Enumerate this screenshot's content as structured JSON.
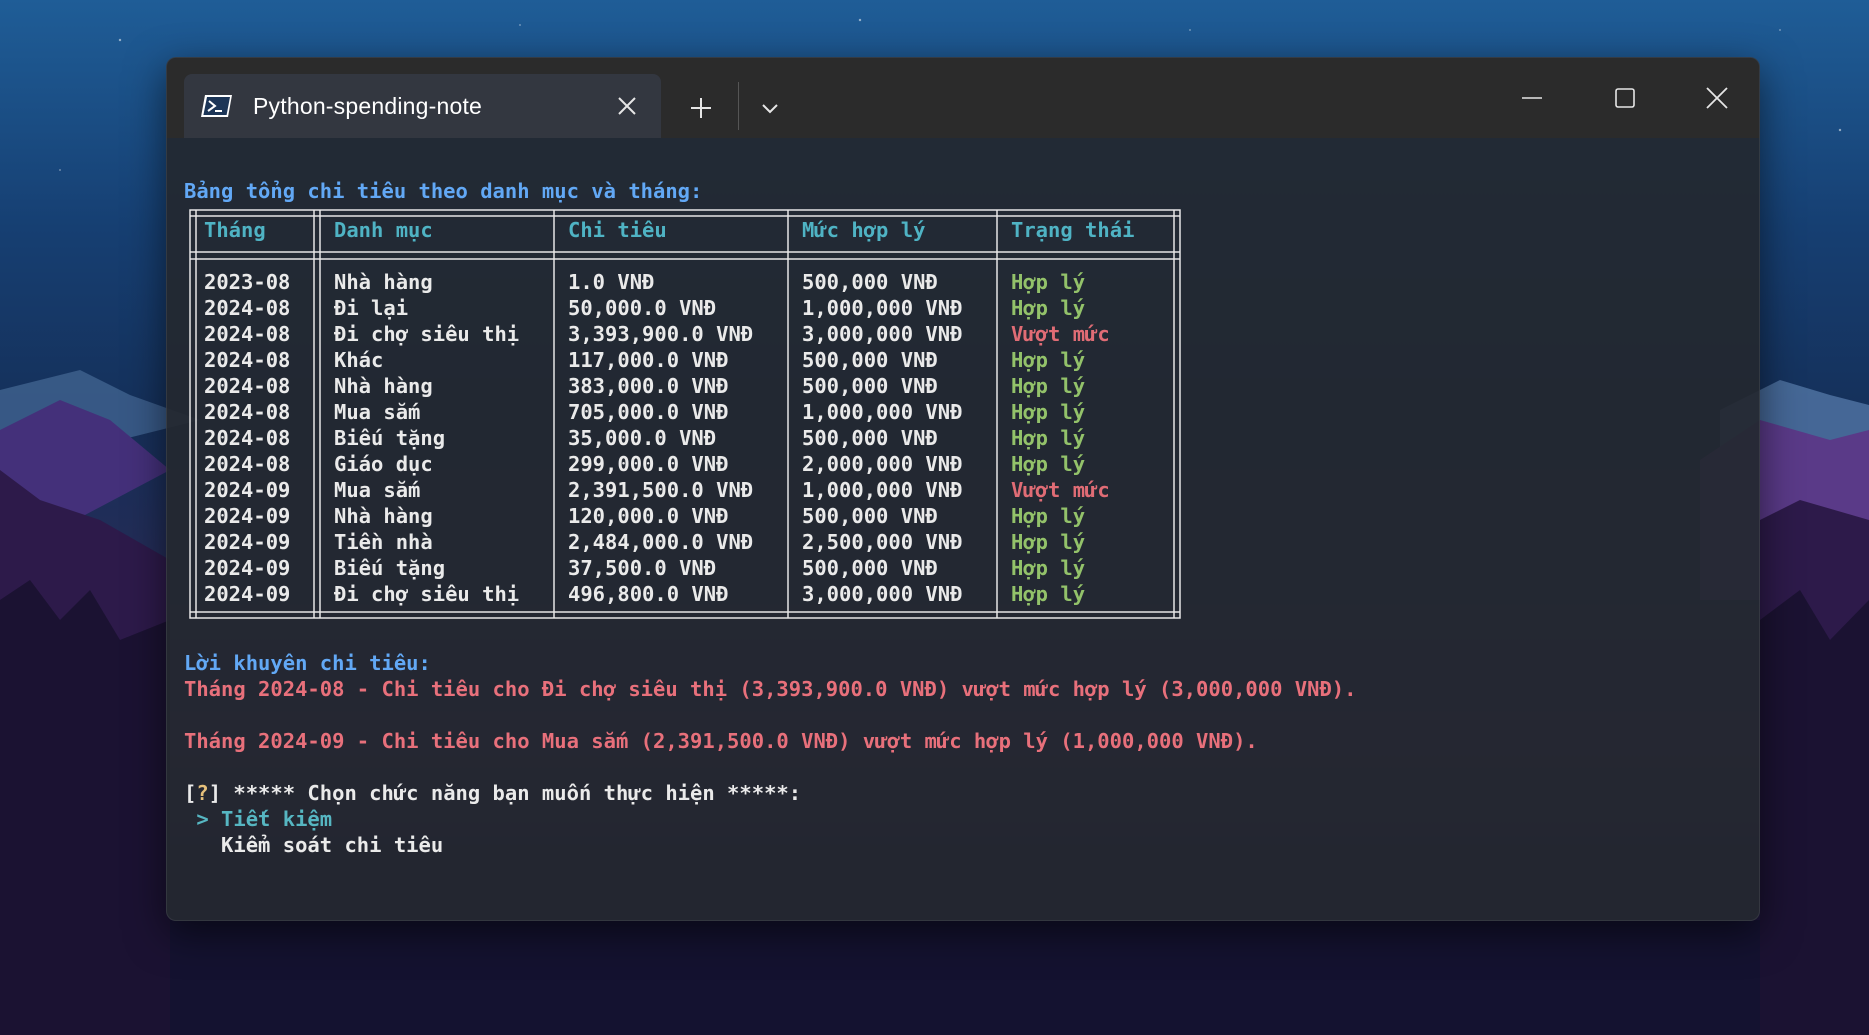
{
  "window": {
    "tab_title": "Python-spending-note",
    "icons": [
      "powershell-icon",
      "close-icon",
      "plus-icon",
      "chevron-down-icon",
      "minimize-icon",
      "maximize-icon",
      "close-window-icon"
    ]
  },
  "terminal": {
    "table_heading": "Bảng tổng chi tiêu theo danh mục và tháng:",
    "headers": [
      "Tháng",
      "Danh mục",
      "Chi tiêu",
      "Mức hợp lý",
      "Trạng thái"
    ],
    "rows": [
      [
        "2023-08",
        "Nhà hàng",
        "1.0 VNĐ",
        "500,000 VNĐ",
        "Hợp lý"
      ],
      [
        "2024-08",
        "Đi lại",
        "50,000.0 VNĐ",
        "1,000,000 VNĐ",
        "Hợp lý"
      ],
      [
        "2024-08",
        "Đi chợ siêu thị",
        "3,393,900.0 VNĐ",
        "3,000,000 VNĐ",
        "Vượt mức"
      ],
      [
        "2024-08",
        "Khác",
        "117,000.0 VNĐ",
        "500,000 VNĐ",
        "Hợp lý"
      ],
      [
        "2024-08",
        "Nhà hàng",
        "383,000.0 VNĐ",
        "500,000 VNĐ",
        "Hợp lý"
      ],
      [
        "2024-08",
        "Mua sắm",
        "705,000.0 VNĐ",
        "1,000,000 VNĐ",
        "Hợp lý"
      ],
      [
        "2024-08",
        "Biếu tặng",
        "35,000.0 VNĐ",
        "500,000 VNĐ",
        "Hợp lý"
      ],
      [
        "2024-08",
        "Giáo dục",
        "299,000.0 VNĐ",
        "2,000,000 VNĐ",
        "Hợp lý"
      ],
      [
        "2024-09",
        "Mua sắm",
        "2,391,500.0 VNĐ",
        "1,000,000 VNĐ",
        "Vượt mức"
      ],
      [
        "2024-09",
        "Nhà hàng",
        "120,000.0 VNĐ",
        "500,000 VNĐ",
        "Hợp lý"
      ],
      [
        "2024-09",
        "Tiền nhà",
        "2,484,000.0 VNĐ",
        "2,500,000 VNĐ",
        "Hợp lý"
      ],
      [
        "2024-09",
        "Biếu tặng",
        "37,500.0 VNĐ",
        "500,000 VNĐ",
        "Hợp lý"
      ],
      [
        "2024-09",
        "Đi chợ siêu thị",
        "496,800.0 VNĐ",
        "3,000,000 VNĐ",
        "Hợp lý"
      ]
    ],
    "status_colors": {
      "Hợp lý": "#93c26a",
      "Vượt mức": "#e06c75"
    },
    "advice_heading": "Lời khuyên chi tiêu:",
    "advice": [
      "Tháng 2024-08 - Chi tiêu cho Đi chợ siêu thị (3,393,900.0 VNĐ) vượt mức hợp lý (3,000,000 VNĐ).",
      "Tháng 2024-09 - Chi tiêu cho Mua sắm (2,391,500.0 VNĐ) vượt mức hợp lý (1,000,000 VNĐ)."
    ],
    "prompt": {
      "bracket_open": "[",
      "q": "?",
      "bracket_close": "]",
      "text": " ***** Chọn chức năng bạn muốn thực hiện *****:"
    },
    "menu": {
      "active_marker": " > ",
      "options": [
        "Tiết kiệm",
        "Kiểm soát chi tiêu"
      ]
    }
  }
}
